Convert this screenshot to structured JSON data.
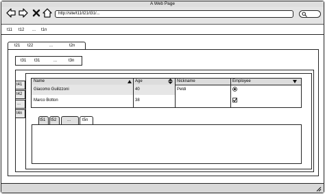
{
  "window": {
    "title": "A Web Page"
  },
  "toolbar": {
    "url": "http://site/t11/t21/t31/..."
  },
  "top_tabs": [
    "t11",
    "t12",
    "...",
    "t1n"
  ],
  "second_tabs": [
    "t21",
    "t22",
    "...",
    "t2n"
  ],
  "third_tabs": [
    "t31",
    "t31",
    "...",
    "t3n"
  ],
  "vertical_tabs": [
    "t41",
    "t42",
    "...",
    "t4n"
  ],
  "grid": {
    "headers": [
      "Name",
      "Age",
      "Nickname",
      "Employee"
    ],
    "rows": [
      {
        "name": "Giacomo Guilizzoni",
        "age": "40",
        "nickname": "Peldi"
      },
      {
        "name": "Marco Botton",
        "age": "38",
        "nickname": ""
      }
    ]
  },
  "bottom_tabs": [
    "t51",
    "t52",
    "...",
    "t5n"
  ]
}
